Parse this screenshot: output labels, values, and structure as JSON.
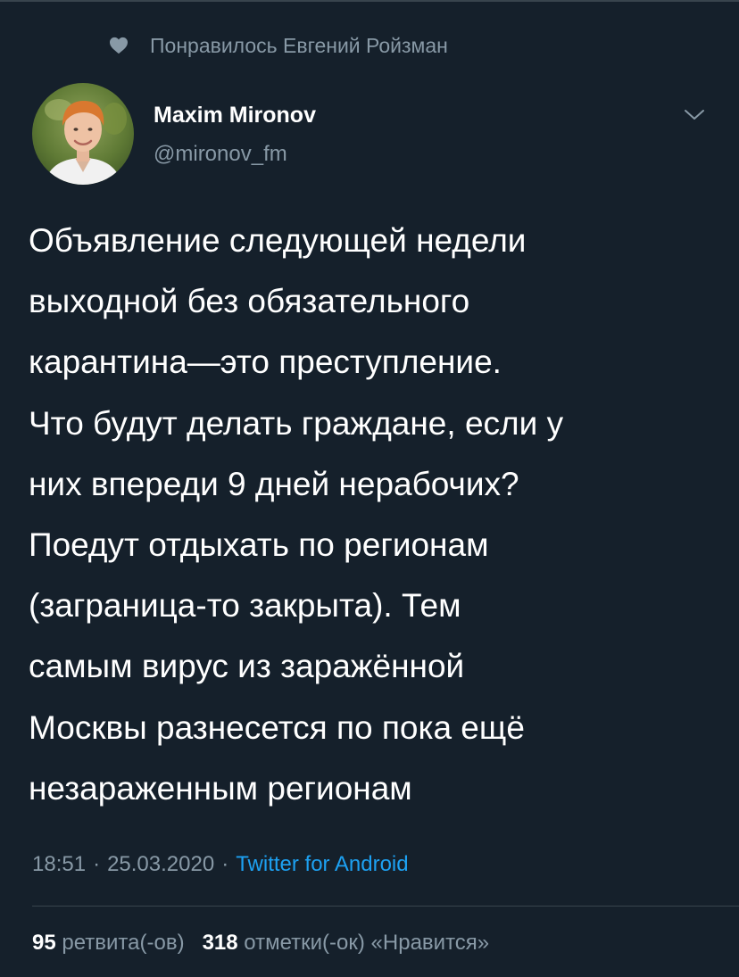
{
  "social_context": {
    "icon": "heart-icon",
    "text": "Понравилось Евгений Ройзман"
  },
  "user": {
    "avatar_icon": "avatar",
    "name": "Maxim Mironov",
    "handle": "@mironov_fm"
  },
  "tweet": {
    "text": "Объявление следующей недели\nвыходной без обязательного\nкарантина—это преступление.\nЧто будут делать граждане, если у\nних впереди 9 дней нерабочих?\nПоедут отдыхать по регионам\n(заграница-то закрыта). Тем\nсамым вирус из заражённой\nМосквы разнесется по пока ещё\nнезараженным регионам",
    "time": "18:51",
    "separator": "·",
    "date": "25.03.2020",
    "source": "Twitter for Android"
  },
  "stats": {
    "retweets_count": "95",
    "retweets_label": "ретвита(-ов)",
    "likes_count": "318",
    "likes_label": "отметки(-ок) «Нравится»"
  },
  "colors": {
    "background": "#15202b",
    "text_primary": "#ffffff",
    "text_secondary": "#8899a6",
    "link": "#1da1f2",
    "divider": "#38444d"
  }
}
